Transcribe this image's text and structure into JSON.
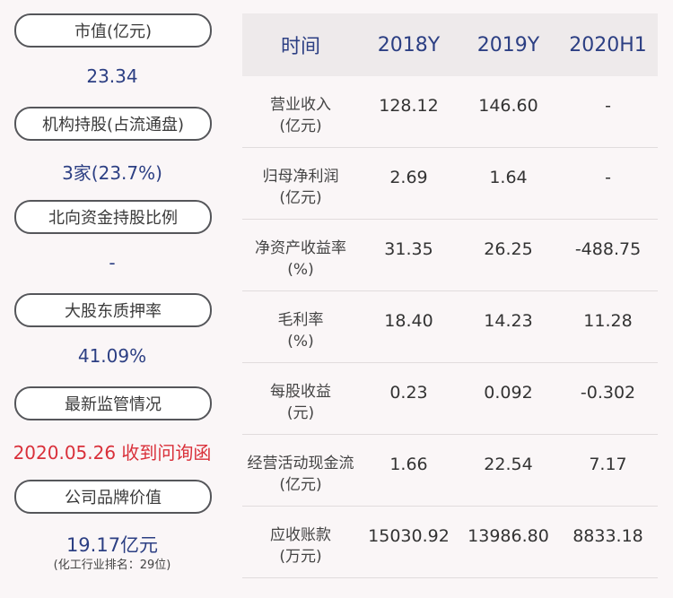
{
  "left_panel": [
    {
      "label": "市值(亿元)",
      "value": "23.34"
    },
    {
      "label": "机构持股(占流通盘)",
      "value": "3家(23.7%)"
    },
    {
      "label": "北向资金持股比例",
      "value": "-"
    },
    {
      "label": "大股东质押率",
      "value": "41.09%"
    },
    {
      "label": "最新监管情况",
      "value": "2020.05.26 收到问询函"
    },
    {
      "label": "公司品牌价值",
      "value": "19.17亿元",
      "note": "(化工行业排名：29位)"
    }
  ],
  "table": {
    "headers": [
      "时间",
      "2018Y",
      "2019Y",
      "2020H1"
    ],
    "rows": [
      {
        "label1": "营业收入",
        "label2": "(亿元)",
        "values": [
          "128.12",
          "146.60",
          "-"
        ]
      },
      {
        "label1": "归母净利润",
        "label2": "(亿元)",
        "values": [
          "2.69",
          "1.64",
          "-"
        ]
      },
      {
        "label1": "净资产收益率",
        "label2": "(%)",
        "values": [
          "31.35",
          "26.25",
          "-488.75"
        ]
      },
      {
        "label1": "毛利率",
        "label2": "(%)",
        "values": [
          "18.40",
          "14.23",
          "11.28"
        ]
      },
      {
        "label1": "每股收益",
        "label2": "(元)",
        "values": [
          "0.23",
          "0.092",
          "-0.302"
        ]
      },
      {
        "label1": "经营活动现金流",
        "label2": "(亿元)",
        "values": [
          "1.66",
          "22.54",
          "7.17"
        ]
      },
      {
        "label1": "应收账款",
        "label2": "(万元)",
        "values": [
          "15030.92",
          "13986.80",
          "8833.18"
        ]
      }
    ]
  },
  "colors": {
    "value_blue": "#2c3f83",
    "alert_red": "#d9303a",
    "background": "#faf6f7",
    "header_bg": "#eeeaeb"
  }
}
